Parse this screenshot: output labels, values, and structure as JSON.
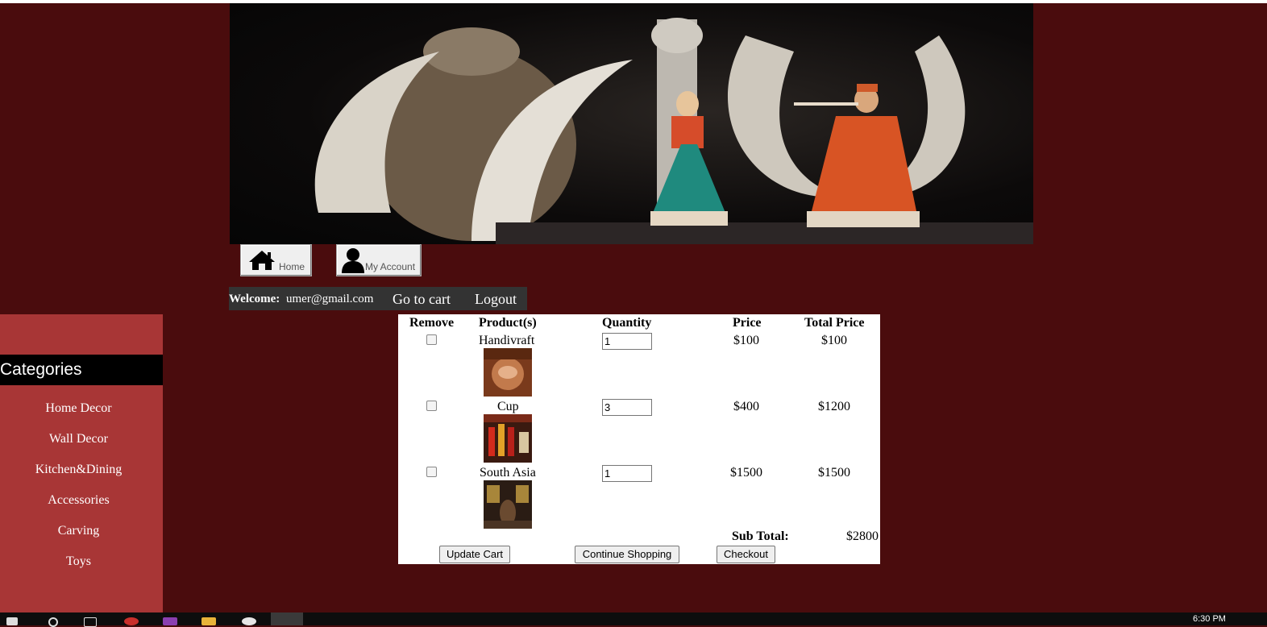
{
  "nav": {
    "home_label": "Home",
    "account_label": "My Account"
  },
  "welcome": {
    "label": "Welcome:",
    "email": "umer@gmail.com",
    "cart_link": "Go to cart",
    "logout_link": "Logout"
  },
  "sidebar": {
    "title": "Categories",
    "items": [
      "Home Decor",
      "Wall Decor",
      "Kitchen&Dining",
      "Accessories",
      "Carving",
      "Toys"
    ]
  },
  "cart": {
    "headers": {
      "remove": "Remove",
      "products": "Product(s)",
      "quantity": "Quantity",
      "price": "Price",
      "total": "Total Price"
    },
    "rows": [
      {
        "name": "Handivraft",
        "quantity": "1",
        "price": "$100",
        "total": "$100",
        "removed": false
      },
      {
        "name": "Cup",
        "quantity": "3",
        "price": "$400",
        "total": "$1200",
        "removed": false
      },
      {
        "name": "South Asia",
        "quantity": "1",
        "price": "$1500",
        "total": "$1500",
        "removed": false
      }
    ],
    "subtotal_label": "Sub Total:",
    "subtotal_value": "$2800",
    "buttons": {
      "update": "Update Cart",
      "continue": "Continue Shopping",
      "checkout": "Checkout"
    }
  },
  "taskbar": {
    "clock": "6:30 PM"
  }
}
